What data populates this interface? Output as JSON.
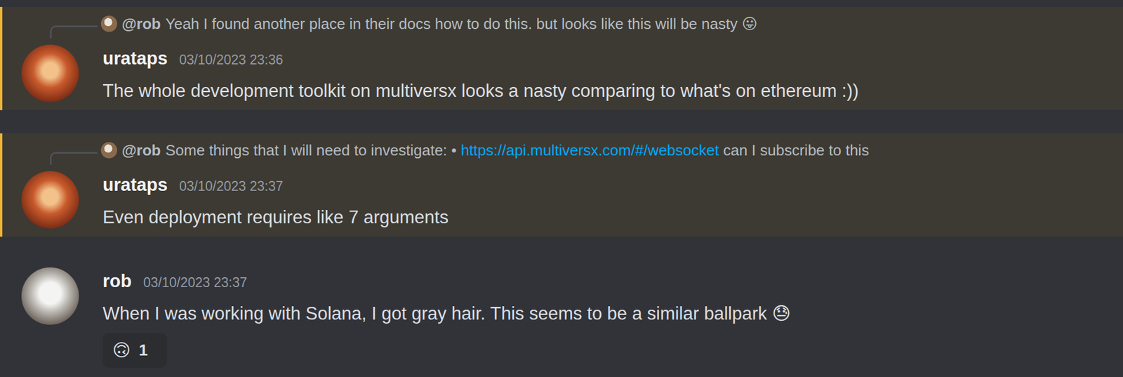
{
  "messages": [
    {
      "highlighted": true,
      "reply": {
        "author": "@rob",
        "parts": [
          {
            "kind": "text",
            "text": "Yeah I found another place in their docs how to do this. but looks like this will be nasty 😛"
          }
        ]
      },
      "author": "urataps",
      "timestamp": "03/10/2023 23:36",
      "content": "The whole development toolkit on multiversx looks a nasty comparing to what's on ethereum :))",
      "reactions": []
    },
    {
      "highlighted": true,
      "reply": {
        "author": "@rob",
        "parts": [
          {
            "kind": "text",
            "text": "Some things that I will need to investigate: • "
          },
          {
            "kind": "link",
            "text": "https://api.multiversx.com/#/websocket"
          },
          {
            "kind": "text",
            "text": " can I subscribe to this"
          }
        ]
      },
      "author": "urataps",
      "timestamp": "03/10/2023 23:37",
      "content": "Even deployment requires like 7 arguments",
      "reactions": []
    },
    {
      "highlighted": false,
      "reply": null,
      "author": "rob",
      "timestamp": "03/10/2023 23:37",
      "content": "When I was working with Solana, I got gray hair. This seems to be a similar ballpark 😓",
      "reactions": [
        {
          "emoji": "🙃",
          "count": "1"
        }
      ]
    }
  ]
}
